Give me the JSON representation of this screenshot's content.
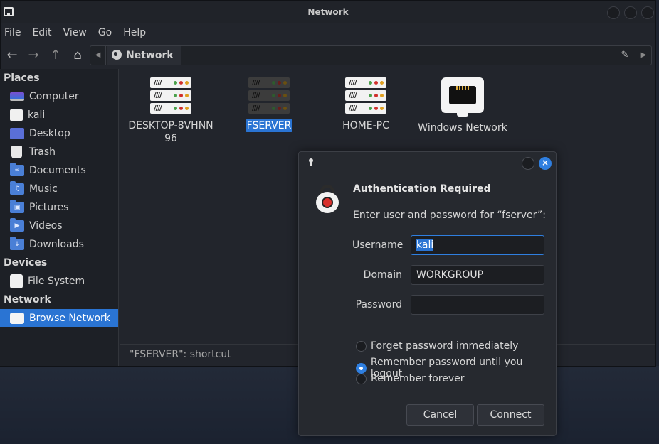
{
  "window": {
    "title": "Network"
  },
  "menu": [
    "File",
    "Edit",
    "View",
    "Go",
    "Help"
  ],
  "pathbar": {
    "location": "Network"
  },
  "sidebar": {
    "places_heading": "Places",
    "places": [
      "Computer",
      "kali",
      "Desktop",
      "Trash",
      "Documents",
      "Music",
      "Pictures",
      "Videos",
      "Downloads"
    ],
    "devices_heading": "Devices",
    "devices": [
      "File System"
    ],
    "network_heading": "Network",
    "network": [
      "Browse Network"
    ]
  },
  "content": {
    "items": [
      {
        "name_line1": "DESKTOP-8VHNN",
        "name_line2": "96",
        "icon": "server-icon"
      },
      {
        "name": "FSERVER",
        "icon": "server-icon",
        "selected": true
      },
      {
        "name": "HOME-PC",
        "icon": "server-icon"
      },
      {
        "name": "Windows Network",
        "icon": "network-icon"
      }
    ]
  },
  "statusbar": {
    "text": "\"FSERVER\": shortcut"
  },
  "dialog": {
    "heading": "Authentication Required",
    "message": "Enter user and password for “fserver”:",
    "username_label": "Username",
    "username_value": "kali",
    "domain_label": "Domain",
    "domain_value": "WORKGROUP",
    "password_label": "Password",
    "password_value": "",
    "options": [
      {
        "label": "Forget password immediately",
        "checked": false
      },
      {
        "label": "Remember password until you logout",
        "checked": true
      },
      {
        "label": "Remember forever",
        "checked": false
      }
    ],
    "cancel": "Cancel",
    "connect": "Connect"
  },
  "colors": {
    "accent": "#2a74d3",
    "window_bg": "#22252c"
  }
}
